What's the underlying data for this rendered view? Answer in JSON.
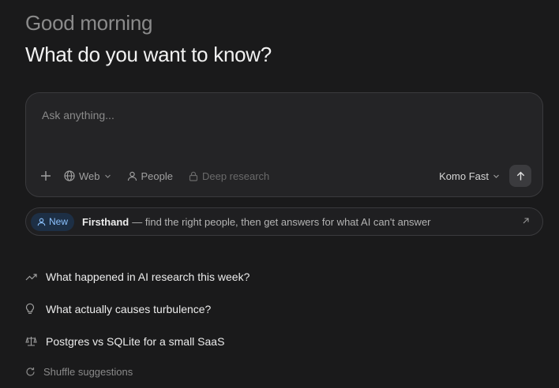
{
  "greeting": "Good morning",
  "headline": "What do you want to know?",
  "composer": {
    "placeholder": "Ask anything...",
    "tools": {
      "web": "Web",
      "people": "People",
      "deep_research": "Deep research"
    },
    "model": "Komo Fast"
  },
  "banner": {
    "badge": "New",
    "title": "Firsthand",
    "text": "— find the right people, then get answers for what AI can't answer"
  },
  "suggestions": [
    {
      "label": "What happened in AI research this week?",
      "icon": "trending-icon"
    },
    {
      "label": "What actually causes turbulence?",
      "icon": "lightbulb-icon"
    },
    {
      "label": "Postgres vs SQLite for a small SaaS",
      "icon": "scale-icon"
    }
  ],
  "shuffle": "Shuffle suggestions",
  "colors": {
    "background": "#1a1a1b",
    "composer": "#242426",
    "badge_bg": "#1d2f45",
    "badge_text": "#8cc2ff"
  }
}
